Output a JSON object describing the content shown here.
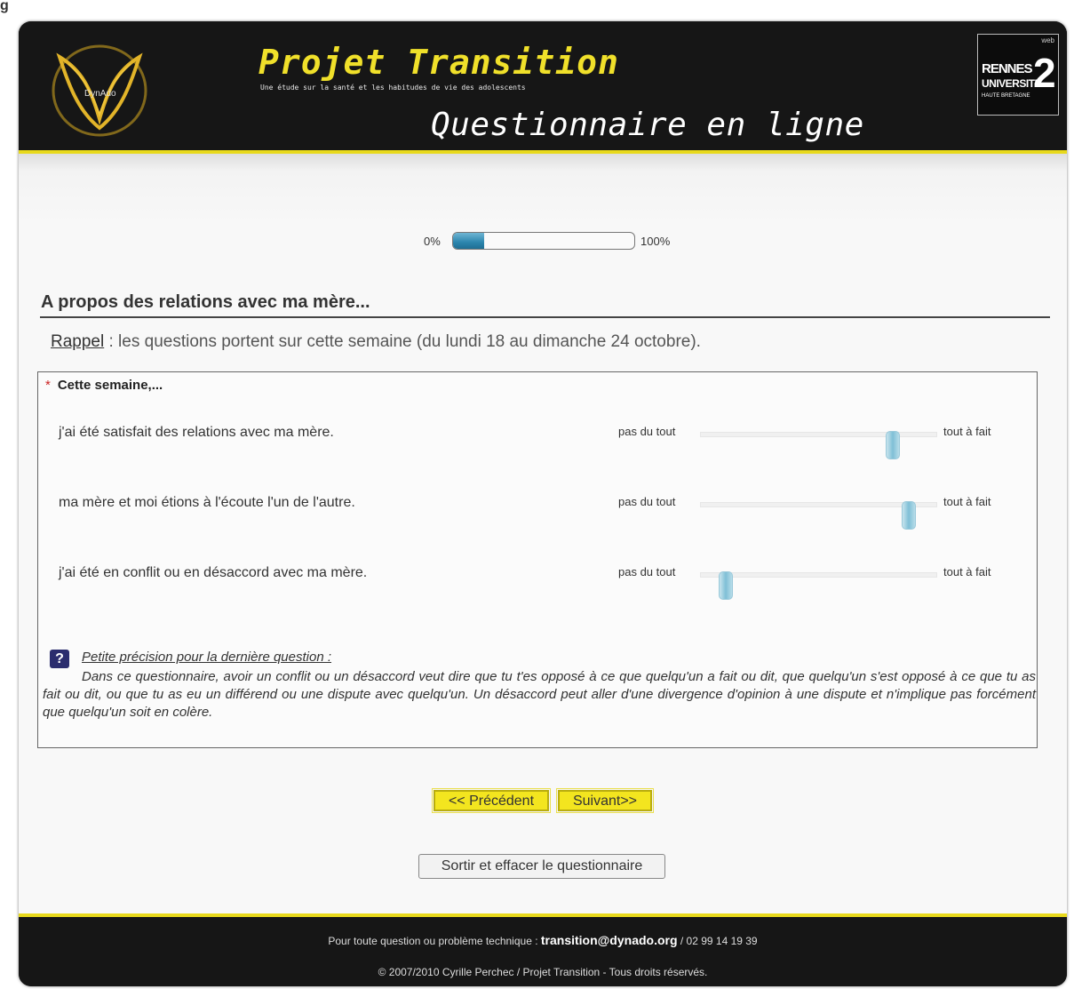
{
  "corner": "g",
  "header": {
    "logo_text": "DynAdo",
    "title": "Projet Transition",
    "subtitle": "Une étude sur la santé et les habitudes de vie des adolescents",
    "page_title": "Questionnaire en ligne",
    "univ": {
      "web": "web",
      "rennes": "RENNES",
      "universite": "UNIVERSITÉ",
      "haute": "HAUTE BRETAGNE",
      "number": "2"
    }
  },
  "progress": {
    "start_label": "0%",
    "end_label": "100%",
    "value_percent": 17
  },
  "section": {
    "title": "A propos des relations avec ma mère...",
    "reminder_link": "Rappel",
    "reminder_text": " : les questions portent sur cette semaine (du lundi 18 au dimanche 24 octobre)."
  },
  "question": {
    "required_marker": "*",
    "heading": "Cette semaine,...",
    "items": [
      {
        "text": "j'ai été satisfait des relations avec ma mère.",
        "low": "pas du tout",
        "high": "tout à fait",
        "value": 0.83
      },
      {
        "text": "ma mère et moi étions à l'écoute l'un de l'autre.",
        "low": "pas du tout",
        "high": "tout à fait",
        "value": 0.9
      },
      {
        "text": "j'ai été en conflit ou en désaccord avec ma mère.",
        "low": "pas du tout",
        "high": "tout à fait",
        "value": 0.08
      }
    ]
  },
  "help": {
    "icon": "?",
    "title": "Petite précision pour la dernière question :",
    "body": "Dans ce questionnaire, avoir un conflit ou un désaccord veut dire que tu t'es opposé à ce que quelqu'un a fait ou dit, que quelqu'un s'est opposé à ce que tu as fait ou dit, ou que tu as eu un différend ou une dispute avec quelqu'un. Un désaccord peut aller d'une divergence d'opinion à une dispute et n'implique pas forcément que quelqu'un soit en colère."
  },
  "buttons": {
    "prev": "<< Précédent",
    "next": "Suivant>>",
    "quit": "Sortir et effacer le questionnaire"
  },
  "footer": {
    "line1_prefix": "Pour toute question ou problème technique : ",
    "email": "transition@dynado.org",
    "line1_suffix": " / 02 99 14 19 39",
    "line2": "© 2007/2010 Cyrille Perchec / Projet Transition - Tous droits réservés."
  },
  "colors": {
    "accent_yellow": "#f3e51f",
    "header_bg": "#161616",
    "progress_blue": "#2b85ad"
  }
}
